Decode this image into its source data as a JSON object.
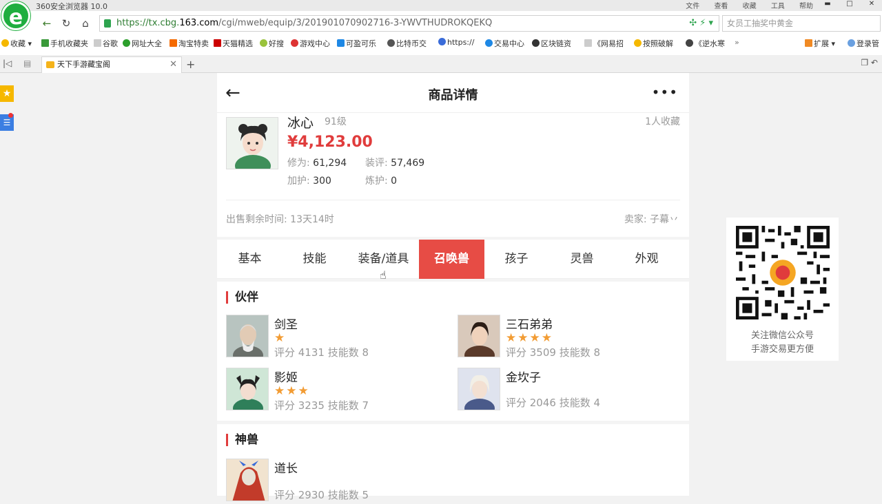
{
  "browser": {
    "window_title": "360安全浏览器 10.0",
    "menus": [
      "文件",
      "查看",
      "收藏",
      "工具",
      "帮助"
    ],
    "url_host_prefix": "https://tx.cbg.",
    "url_host_main": "163.com",
    "url_path": "/cgi/mweb/equip/3/201901070902716-3-YWVTHUDROKQEKQ",
    "search_placeholder": "女员工抽奖中黄金",
    "bookmarks": [
      "收藏",
      "手机收藏夹",
      "谷歌",
      "网址大全",
      "淘宝特卖",
      "天猫精选",
      "好搜",
      "游戏中心",
      "可盈可乐",
      "比特币交",
      "https://",
      "交易中心",
      "区块链资",
      "《网易招",
      "按照破解",
      "《逆水寒"
    ],
    "bookmarks_right": [
      "扩展",
      "登录管"
    ],
    "tab_title": "天下手游藏宝阁"
  },
  "header": {
    "title": "商品详情",
    "more": "•••"
  },
  "character": {
    "name": "冰心",
    "level": "91级",
    "favorites": "1人收藏",
    "price": "¥4,123.00",
    "stats": [
      {
        "key": "修为:",
        "value": "61,294"
      },
      {
        "key": "装评:",
        "value": "57,469"
      },
      {
        "key": "加护:",
        "value": "300"
      },
      {
        "key": "炼护:",
        "value": "0"
      }
    ],
    "remaining": "出售剩余时间: 13天14时",
    "seller": "卖家: 子幕丷"
  },
  "tabs": [
    "基本",
    "技能",
    "装备/道具",
    "召唤兽",
    "孩子",
    "灵兽",
    "外观"
  ],
  "active_tab": "召唤兽",
  "sections": [
    {
      "title": "伙伴",
      "pets": [
        {
          "name": "剑圣",
          "stars": "★",
          "score": "评分 4131 技能数 8"
        },
        {
          "name": "三石弟弟",
          "stars": "★★★★",
          "score": "评分 3509 技能数 8"
        },
        {
          "name": "影姬",
          "stars": "★★★",
          "score": "评分 3235 技能数 7"
        },
        {
          "name": "金坎子",
          "stars": "",
          "score": "评分 2046 技能数 4"
        }
      ]
    },
    {
      "title": "神兽",
      "pets": [
        {
          "name": "道长",
          "stars": "",
          "score": "评分 2930 技能数 5"
        }
      ]
    }
  ],
  "qr": {
    "line1": "关注微信公众号",
    "line2": "手游交易更方便"
  },
  "colors": {
    "accent": "#e74c45",
    "price": "#e03c3c",
    "star": "#f29c34"
  }
}
